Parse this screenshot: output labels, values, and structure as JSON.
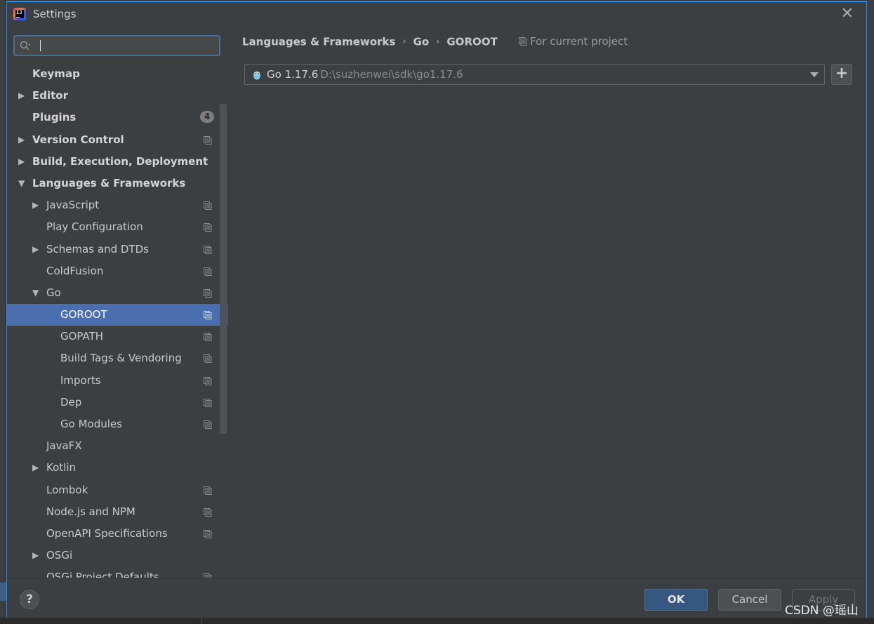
{
  "window": {
    "title": "Settings",
    "app_icon": "intellij-idea-icon"
  },
  "search": {
    "value": "",
    "placeholder": ""
  },
  "tree": [
    {
      "label": "Keymap",
      "level": 0,
      "bold": true,
      "arrow": "none",
      "project_icon": false
    },
    {
      "label": "Editor",
      "level": 0,
      "bold": true,
      "arrow": "collapsed",
      "project_icon": false
    },
    {
      "label": "Plugins",
      "level": 0,
      "bold": true,
      "arrow": "none",
      "project_icon": false,
      "badge": "4"
    },
    {
      "label": "Version Control",
      "level": 0,
      "bold": true,
      "arrow": "collapsed",
      "project_icon": true
    },
    {
      "label": "Build, Execution, Deployment",
      "level": 0,
      "bold": true,
      "arrow": "collapsed",
      "project_icon": false
    },
    {
      "label": "Languages & Frameworks",
      "level": 0,
      "bold": true,
      "arrow": "expanded",
      "project_icon": false
    },
    {
      "label": "JavaScript",
      "level": 1,
      "bold": false,
      "arrow": "collapsed",
      "project_icon": true
    },
    {
      "label": "Play Configuration",
      "level": 1,
      "bold": false,
      "arrow": "none",
      "project_icon": true
    },
    {
      "label": "Schemas and DTDs",
      "level": 1,
      "bold": false,
      "arrow": "collapsed",
      "project_icon": true
    },
    {
      "label": "ColdFusion",
      "level": 1,
      "bold": false,
      "arrow": "none",
      "project_icon": true
    },
    {
      "label": "Go",
      "level": 1,
      "bold": false,
      "arrow": "expanded",
      "project_icon": true
    },
    {
      "label": "GOROOT",
      "level": 2,
      "bold": false,
      "arrow": "none",
      "project_icon": true,
      "selected": true
    },
    {
      "label": "GOPATH",
      "level": 2,
      "bold": false,
      "arrow": "none",
      "project_icon": true
    },
    {
      "label": "Build Tags & Vendoring",
      "level": 2,
      "bold": false,
      "arrow": "none",
      "project_icon": true
    },
    {
      "label": "Imports",
      "level": 2,
      "bold": false,
      "arrow": "none",
      "project_icon": true
    },
    {
      "label": "Dep",
      "level": 2,
      "bold": false,
      "arrow": "none",
      "project_icon": true
    },
    {
      "label": "Go Modules",
      "level": 2,
      "bold": false,
      "arrow": "none",
      "project_icon": true
    },
    {
      "label": "JavaFX",
      "level": 1,
      "bold": false,
      "arrow": "none",
      "project_icon": false
    },
    {
      "label": "Kotlin",
      "level": 1,
      "bold": false,
      "arrow": "collapsed",
      "project_icon": false
    },
    {
      "label": "Lombok",
      "level": 1,
      "bold": false,
      "arrow": "none",
      "project_icon": true
    },
    {
      "label": "Node.js and NPM",
      "level": 1,
      "bold": false,
      "arrow": "none",
      "project_icon": true
    },
    {
      "label": "OpenAPI Specifications",
      "level": 1,
      "bold": false,
      "arrow": "none",
      "project_icon": true
    },
    {
      "label": "OSGi",
      "level": 1,
      "bold": false,
      "arrow": "collapsed",
      "project_icon": false
    },
    {
      "label": "OSGi Project Defaults",
      "level": 1,
      "bold": false,
      "arrow": "none",
      "project_icon": true
    }
  ],
  "breadcrumb": {
    "items": [
      "Languages & Frameworks",
      "Go",
      "GOROOT"
    ],
    "separator": "›"
  },
  "scope": {
    "label": "For current project"
  },
  "sdk": {
    "name": "Go 1.17.6",
    "path": "D:\\suzhenwei\\sdk\\go1.17.6",
    "icon": "gopher-icon"
  },
  "add_button": {
    "label": "+"
  },
  "footer": {
    "help_label": "?",
    "ok_label": "OK",
    "cancel_label": "Cancel",
    "apply_label": "Apply"
  },
  "watermark": "CSDN @瑶山",
  "colors": {
    "accent": "#4b6eaf",
    "ok_button": "#365880",
    "dialog_bg": "#3c3f41"
  }
}
